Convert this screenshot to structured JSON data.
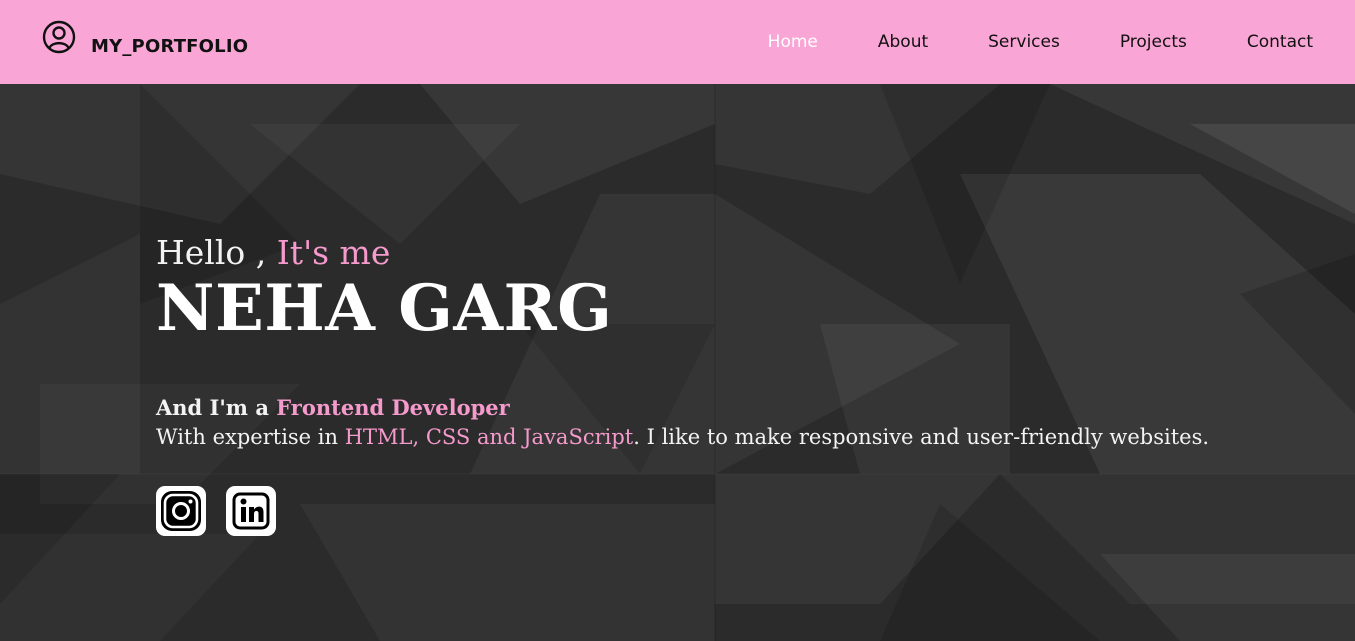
{
  "brand": {
    "name": "MY_PORTFOLIO",
    "icon": "user-circle-icon"
  },
  "nav": {
    "items": [
      {
        "label": "Home",
        "active": true
      },
      {
        "label": "About",
        "active": false
      },
      {
        "label": "Services",
        "active": false
      },
      {
        "label": "Projects",
        "active": false
      },
      {
        "label": "Contact",
        "active": false
      }
    ]
  },
  "hero": {
    "greeting_prefix": "Hello , ",
    "greeting_accent": "It's me",
    "name": "NEHA GARG",
    "role_prefix": "And I'm a ",
    "role_accent": "Frontend Developer",
    "desc_prefix": "With expertise in ",
    "desc_accent": "HTML, CSS and JavaScript",
    "desc_suffix": ". I like to make responsive and user-friendly websites."
  },
  "socials": [
    {
      "name": "instagram",
      "icon": "instagram-icon"
    },
    {
      "name": "linkedin",
      "icon": "linkedin-icon"
    }
  ],
  "colors": {
    "navbar": "#f9a5d5",
    "accent": "#f59acc",
    "background": "#2b2b2b",
    "text": "#f3f3f3"
  }
}
